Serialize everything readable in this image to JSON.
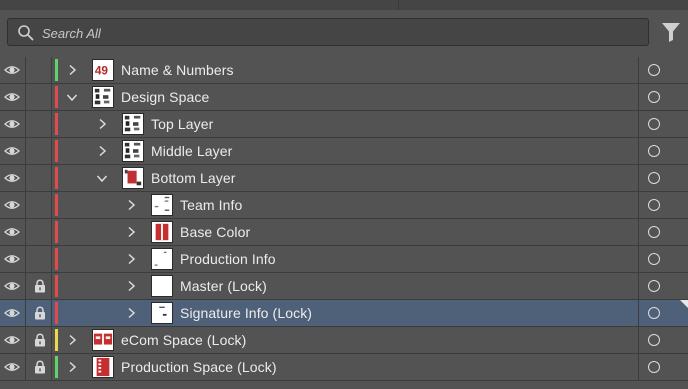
{
  "search": {
    "placeholder": "Search All"
  },
  "icons": {
    "search": "search-icon",
    "filter": "filter-icon",
    "visibility": "eye-icon",
    "lock": "lock-icon",
    "expand": "chevron-right-icon",
    "collapse": "chevron-down-icon",
    "target": "target-circle-icon"
  },
  "colors": {
    "panel_bg": "#535353",
    "selected_row": "#4e6179",
    "layer_green": "#62d36b",
    "layer_red": "#e14b4b",
    "layer_yellow": "#ecd84a"
  },
  "layers": [
    {
      "name": "Name & Numbers",
      "depth": 0,
      "expanded": false,
      "locked": false,
      "visible": true,
      "color": "#62d36b",
      "thumb": "numbers",
      "selected": false
    },
    {
      "name": "Design Space",
      "depth": 0,
      "expanded": true,
      "locked": false,
      "visible": true,
      "color": "#e14b4b",
      "thumb": "design",
      "selected": false
    },
    {
      "name": "Top Layer",
      "depth": 1,
      "expanded": false,
      "locked": false,
      "visible": true,
      "color": "#e14b4b",
      "thumb": "design",
      "selected": false
    },
    {
      "name": "Middle Layer",
      "depth": 1,
      "expanded": false,
      "locked": false,
      "visible": true,
      "color": "#e14b4b",
      "thumb": "design",
      "selected": false
    },
    {
      "name": "Bottom Layer",
      "depth": 1,
      "expanded": true,
      "locked": false,
      "visible": true,
      "color": "#e14b4b",
      "thumb": "bottom",
      "selected": false
    },
    {
      "name": "Team Info",
      "depth": 2,
      "expanded": false,
      "locked": false,
      "visible": true,
      "color": "#e14b4b",
      "thumb": "team",
      "selected": false
    },
    {
      "name": "Base Color",
      "depth": 2,
      "expanded": false,
      "locked": false,
      "visible": true,
      "color": "#e14b4b",
      "thumb": "base",
      "selected": false
    },
    {
      "name": "Production Info",
      "depth": 2,
      "expanded": false,
      "locked": false,
      "visible": true,
      "color": "#e14b4b",
      "thumb": "production",
      "selected": false
    },
    {
      "name": "Master (Lock)",
      "depth": 2,
      "expanded": false,
      "locked": true,
      "visible": true,
      "color": "#e14b4b",
      "thumb": "blank",
      "selected": false
    },
    {
      "name": "Signature Info (Lock)",
      "depth": 2,
      "expanded": false,
      "locked": true,
      "visible": true,
      "color": "#e14b4b",
      "thumb": "signature",
      "selected": true
    },
    {
      "name": "eCom Space (Lock)",
      "depth": 0,
      "expanded": false,
      "locked": true,
      "visible": true,
      "color": "#ecd84a",
      "thumb": "ecom",
      "selected": false
    },
    {
      "name": "Production Space (Lock)",
      "depth": 0,
      "expanded": false,
      "locked": true,
      "visible": true,
      "color": "#62d36b",
      "thumb": "prodspace",
      "selected": false
    }
  ]
}
